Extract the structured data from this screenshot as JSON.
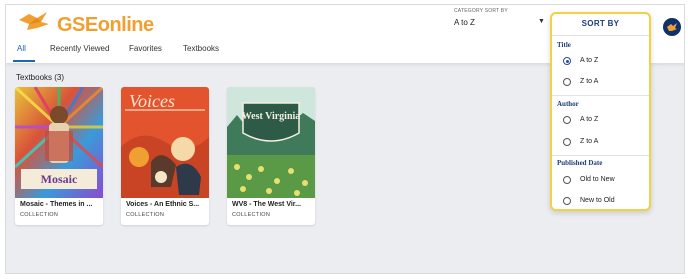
{
  "header": {
    "logo_text": "GSEonline",
    "category_sort_label": "CATEGORY SORT BY",
    "category_sort_value": "A to Z",
    "tabs": [
      {
        "label": "All",
        "active": true
      },
      {
        "label": "Recently Viewed",
        "active": false
      },
      {
        "label": "Favorites",
        "active": false
      },
      {
        "label": "Textbooks",
        "active": false
      }
    ]
  },
  "main": {
    "section_title": "Textbooks (3)",
    "cards": [
      {
        "title": "Mosaic - Themes in ...",
        "type": "COLLECTION",
        "cover_text": "Mosaic"
      },
      {
        "title": "Voices - An Ethnic S...",
        "type": "COLLECTION",
        "cover_text": "Voices"
      },
      {
        "title": "WV8 - The West Vir...",
        "type": "COLLECTION",
        "cover_text": "West Virginia"
      }
    ]
  },
  "sort_panel": {
    "title": "SORT BY",
    "groups": [
      {
        "label": "Title",
        "options": [
          {
            "label": "A to Z",
            "checked": true
          },
          {
            "label": "Z to A",
            "checked": false
          }
        ]
      },
      {
        "label": "Author",
        "options": [
          {
            "label": "A to Z",
            "checked": false
          },
          {
            "label": "Z to A",
            "checked": false
          }
        ]
      },
      {
        "label": "Published Date",
        "options": [
          {
            "label": "Old to New",
            "checked": false
          },
          {
            "label": "New to Old",
            "checked": false
          }
        ]
      }
    ]
  },
  "colors": {
    "accent": "#1a66b8",
    "logo": "#f0a030",
    "panel_border": "#f2d144",
    "panel_heading": "#1a3b78"
  }
}
